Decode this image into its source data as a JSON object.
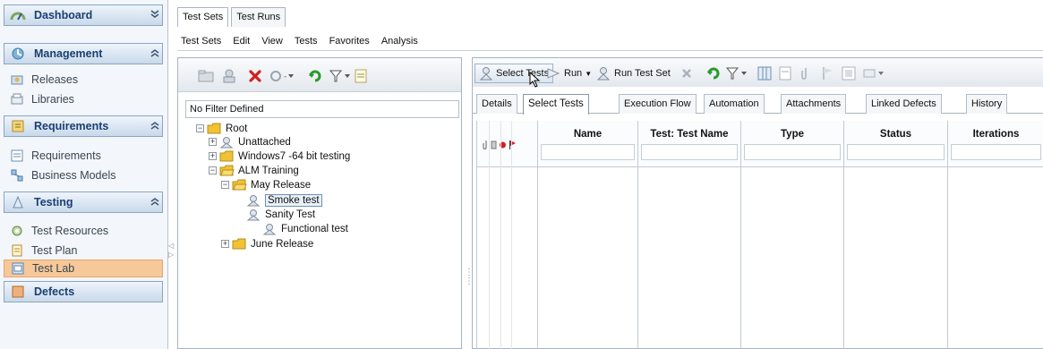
{
  "nav": {
    "groups": [
      {
        "label": "Dashboard",
        "icon": "dashboard-icon",
        "chevron": "double-chevron-down"
      },
      {
        "label": "Management",
        "icon": "management-icon",
        "chevron": "double-chevron-up"
      },
      {
        "label": "Requirements",
        "icon": "requirements-icon",
        "chevron": "double-chevron-up"
      },
      {
        "label": "Testing",
        "icon": "testing-icon",
        "chevron": "double-chevron-up"
      },
      {
        "label": "Defects",
        "icon": "defects-icon"
      }
    ],
    "items": {
      "releases": "Releases",
      "libraries": "Libraries",
      "requirements": "Requirements",
      "business_models": "Business Models",
      "test_resources": "Test Resources",
      "test_plan": "Test Plan",
      "test_lab": "Test Lab"
    },
    "selected": "Test Lab"
  },
  "module_tabs": [
    "Test Sets",
    "Test Runs"
  ],
  "menu": [
    "Test Sets",
    "Edit",
    "View",
    "Tests",
    "Favorites",
    "Analysis"
  ],
  "tree": {
    "filter_text": "No Filter Defined",
    "nodes": {
      "root": "Root",
      "unattached": "Unattached",
      "windows7": "Windows7 -64 bit testing",
      "alm_training": "ALM Training",
      "may_release": "May Release",
      "smoke_test": "Smoke test",
      "sanity_test": "Sanity Test",
      "functional_test": "Functional test",
      "june_release": "June Release"
    },
    "selected": "Smoke test"
  },
  "right_toolbar": {
    "select_tests": "Select Tests",
    "run": "Run",
    "run_test_set": "Run Test Set"
  },
  "subtabs": [
    "Details",
    "Select Tests",
    "Execution Flow",
    "Automation",
    "Attachments",
    "Linked Defects",
    "History"
  ],
  "active_subtab": "Select Tests",
  "grid": {
    "columns": [
      "Name",
      "Test: Test Name",
      "Type",
      "Status",
      "Iterations"
    ]
  },
  "colors": {
    "nav_selected": "#f6c89a",
    "header_text": "#1b3f73",
    "folder": "#f1c232",
    "delete_red": "#d22020",
    "refresh_green": "#2a9a2a"
  }
}
